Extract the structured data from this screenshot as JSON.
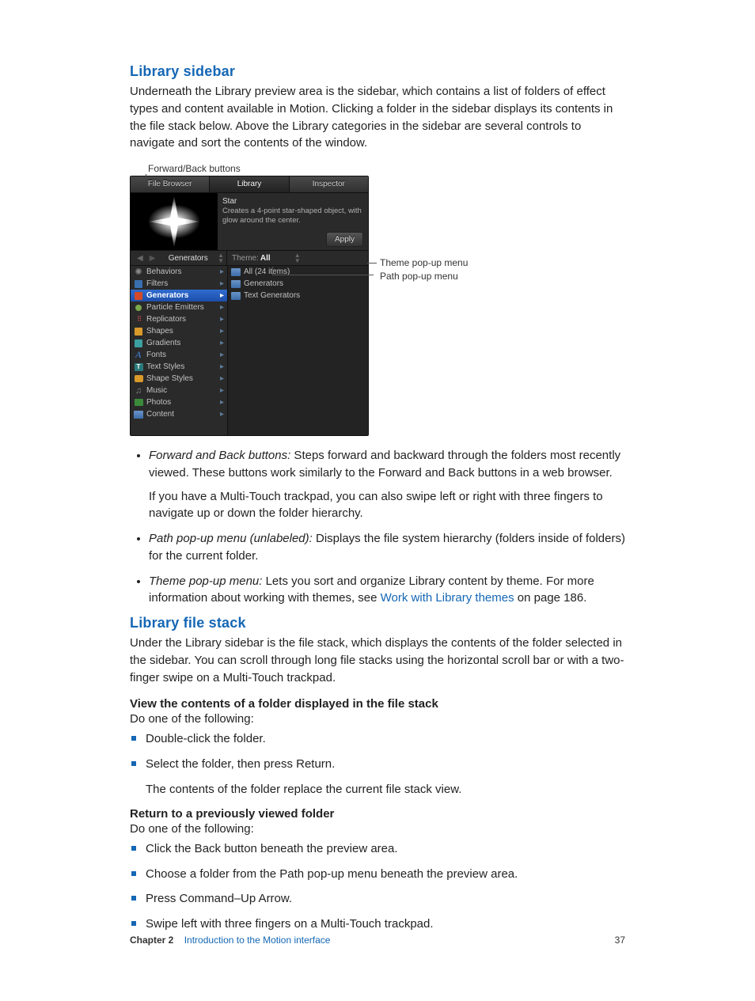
{
  "section1": {
    "heading": "Library sidebar",
    "para": "Underneath the Library preview area is the sidebar, which contains a list of folders of effect types and content available in Motion. Clicking a folder in the sidebar displays its contents in the file stack below. Above the Library categories in the sidebar are several controls to navigate and sort the contents of the window."
  },
  "figure": {
    "callout_top": "Forward/Back buttons",
    "callout_theme": "Theme pop-up menu",
    "callout_path": "Path pop-up menu",
    "tabs": [
      "File Browser",
      "Library",
      "Inspector"
    ],
    "preview_title": "Star",
    "preview_desc": "Creates a 4-point star-shaped object, with glow around the center.",
    "apply": "Apply",
    "nav_label": "Generators",
    "theme_label": "Theme: ",
    "theme_value": "All",
    "left_items": [
      {
        "label": "Behaviors",
        "color": "#8a8a8a",
        "icon": "gear"
      },
      {
        "label": "Filters",
        "color": "#3a6fb0",
        "icon": "sq"
      },
      {
        "label": "Generators",
        "color": "#d24a2a",
        "icon": "sq",
        "selected": true
      },
      {
        "label": "Particle Emitters",
        "color": "#7aa84c",
        "icon": "dot"
      },
      {
        "label": "Replicators",
        "color": "#c94b4b",
        "icon": "grid"
      },
      {
        "label": "Shapes",
        "color": "#d99a2a",
        "icon": "sq"
      },
      {
        "label": "Gradients",
        "color": "#3aa0a0",
        "icon": "sq"
      },
      {
        "label": "Fonts",
        "color": "#3a6fb0",
        "icon": "A"
      },
      {
        "label": "Text Styles",
        "color": "#2a7a7a",
        "icon": "T"
      },
      {
        "label": "Shape Styles",
        "color": "#d99a2a",
        "icon": "s"
      },
      {
        "label": "Music",
        "color": "#888",
        "icon": "note"
      },
      {
        "label": "Photos",
        "color": "#3a8a3a",
        "icon": "img"
      },
      {
        "label": "Content",
        "color": "#6a94c8",
        "icon": "folder"
      }
    ],
    "right_items": [
      {
        "label": "All (24 items)"
      },
      {
        "label": "Generators"
      },
      {
        "label": "Text Generators"
      }
    ]
  },
  "bullets": [
    {
      "term": "Forward and Back buttons:",
      "text": " Steps forward and backward through the folders most recently viewed. These buttons work similarly to the Forward and Back buttons in a web browser.",
      "sub": "If you have a Multi-Touch trackpad, you can also swipe left or right with three fingers to navigate up or down the folder hierarchy."
    },
    {
      "term": "Path pop-up menu (unlabeled):",
      "text": " Displays the file system hierarchy (folders inside of folders) for the current folder."
    },
    {
      "term": "Theme pop-up menu:",
      "text": " Lets you sort and organize Library content by theme. For more information about working with themes, see ",
      "link": "Work with Library themes",
      "tail": " on page 186."
    }
  ],
  "section2": {
    "heading": "Library file stack",
    "para": "Under the Library sidebar is the file stack, which displays the contents of the folder selected in the sidebar. You can scroll through long file stacks using the horizontal scroll bar or with a two-finger swipe on a Multi-Touch trackpad."
  },
  "task1": {
    "head": "View the contents of a folder displayed in the file stack",
    "lead": "Do one of the following:",
    "items": [
      "Double-click the folder.",
      "Select the folder, then press Return."
    ],
    "after": "The contents of the folder replace the current file stack view."
  },
  "task2": {
    "head": "Return to a previously viewed folder",
    "lead": "Do one of the following:",
    "items": [
      "Click the Back button beneath the preview area.",
      "Choose a folder from the Path pop-up menu beneath the preview area.",
      "Press Command–Up Arrow.",
      "Swipe left with three fingers on a Multi-Touch trackpad."
    ]
  },
  "footer": {
    "chapter": "Chapter 2",
    "title": "Introduction to the Motion interface",
    "page": "37"
  }
}
